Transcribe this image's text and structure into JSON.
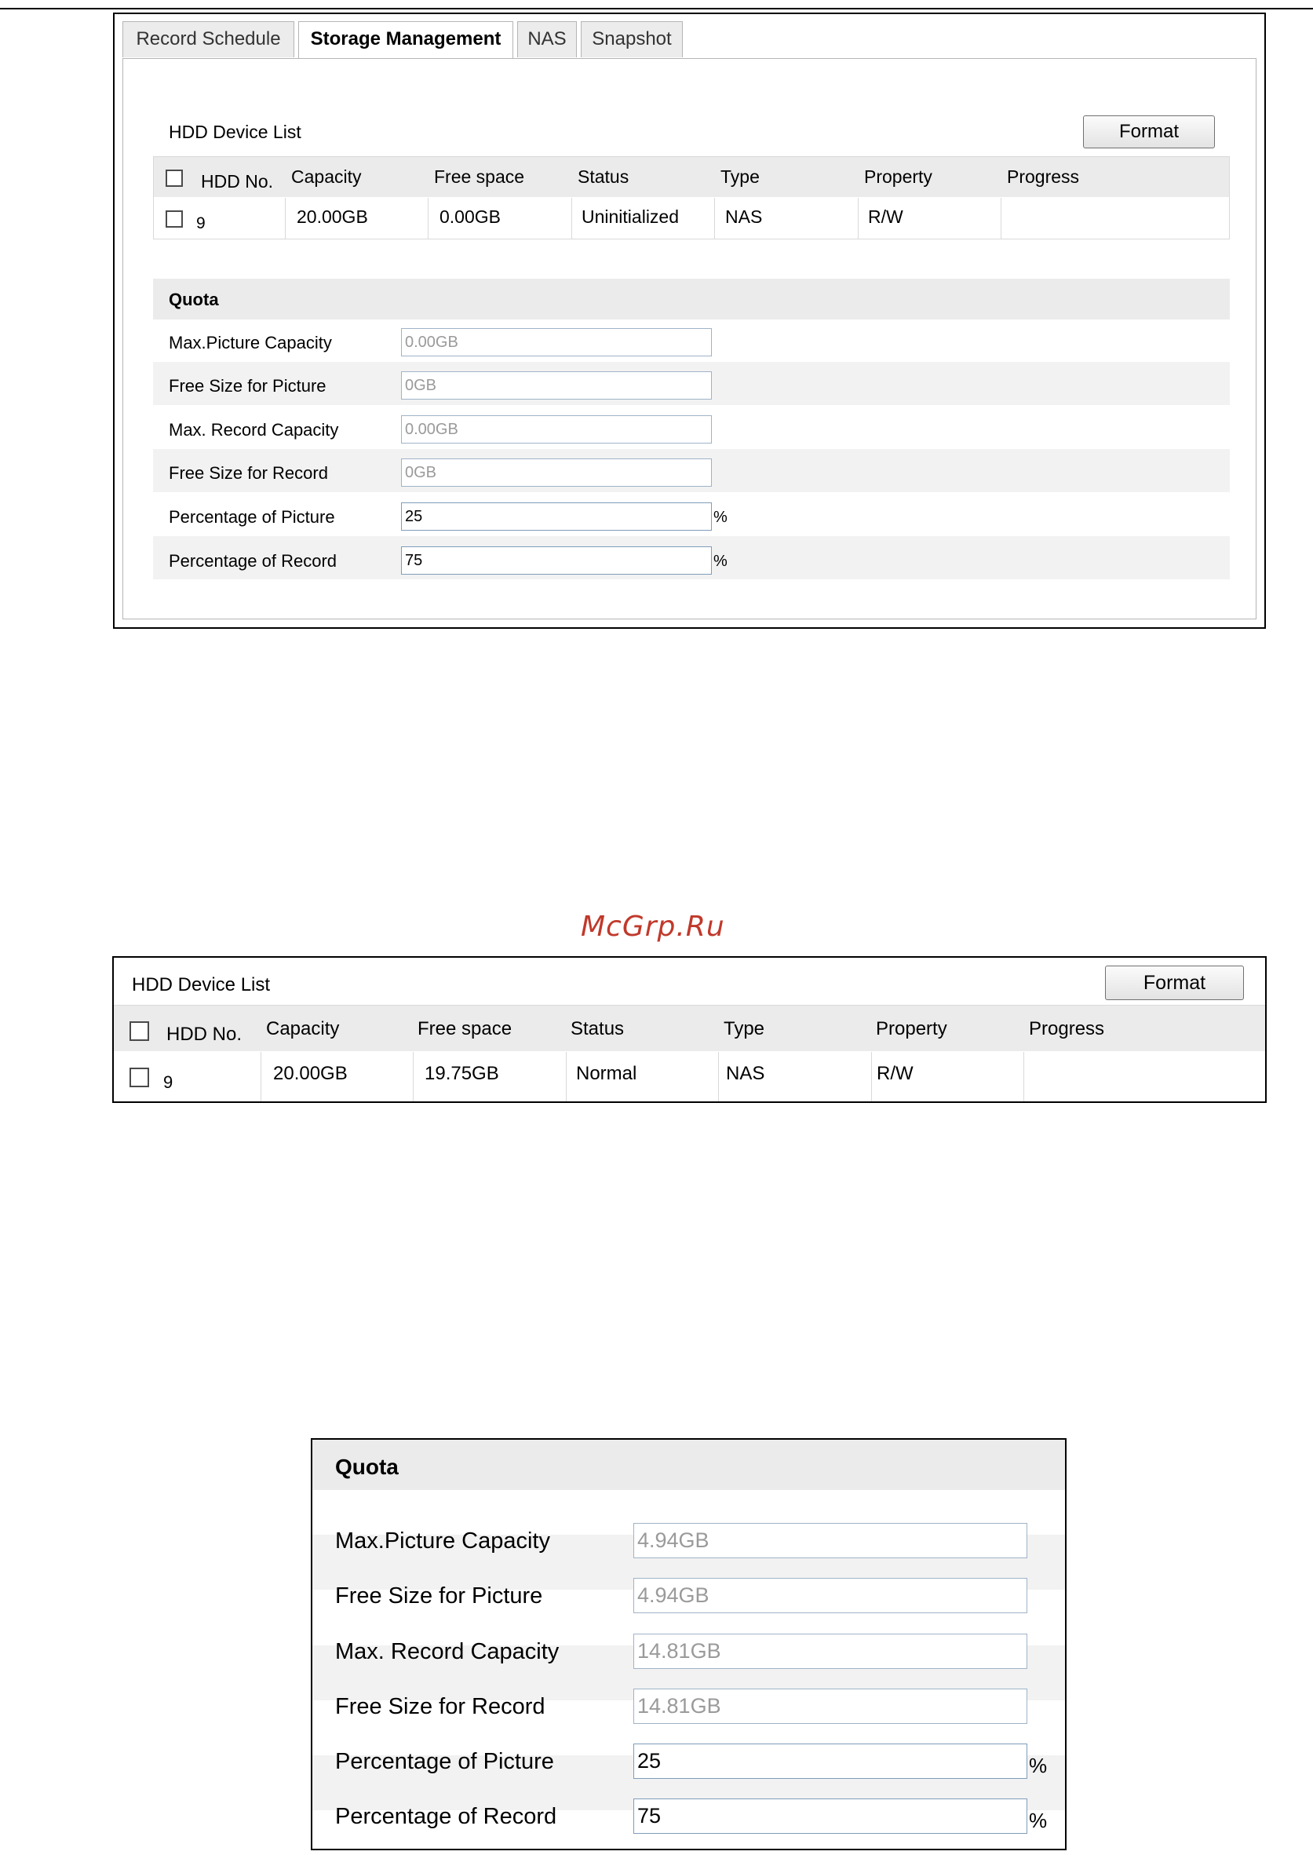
{
  "watermark": "McGrp.Ru",
  "panel1": {
    "tabs": [
      {
        "label": "Record Schedule",
        "active": false
      },
      {
        "label": "Storage Management",
        "active": true
      },
      {
        "label": "NAS",
        "active": false
      },
      {
        "label": "Snapshot",
        "active": false
      }
    ],
    "hdd_title": "HDD Device List",
    "format_label": "Format",
    "columns": [
      "HDD No.",
      "Capacity",
      "Free space",
      "Status",
      "Type",
      "Property",
      "Progress"
    ],
    "row": {
      "hdd_no": "9",
      "capacity": "20.00GB",
      "free_space": "0.00GB",
      "status": "Uninitialized",
      "type": "NAS",
      "property": "R/W",
      "progress": ""
    },
    "quota_title": "Quota",
    "quota": [
      {
        "label": "Max.Picture Capacity",
        "value": "0.00GB",
        "editable": false
      },
      {
        "label": "Free Size for Picture",
        "value": "0GB",
        "editable": false
      },
      {
        "label": "Max. Record Capacity",
        "value": "0.00GB",
        "editable": false
      },
      {
        "label": "Free Size for Record",
        "value": "0GB",
        "editable": false
      },
      {
        "label": "Percentage of Picture",
        "value": "25",
        "editable": true
      },
      {
        "label": "Percentage of Record",
        "value": "75",
        "editable": true
      }
    ],
    "percent_sign": "%"
  },
  "panel2": {
    "hdd_title": "HDD Device List",
    "format_label": "Format",
    "columns": [
      "HDD No.",
      "Capacity",
      "Free space",
      "Status",
      "Type",
      "Property",
      "Progress"
    ],
    "row": {
      "hdd_no": "9",
      "capacity": "20.00GB",
      "free_space": "19.75GB",
      "status": "Normal",
      "type": "NAS",
      "property": "R/W",
      "progress": ""
    }
  },
  "panel3": {
    "quota_title": "Quota",
    "quota": [
      {
        "label": "Max.Picture Capacity",
        "value": "4.94GB",
        "editable": false
      },
      {
        "label": "Free Size for Picture",
        "value": "4.94GB",
        "editable": false
      },
      {
        "label": "Max. Record Capacity",
        "value": "14.81GB",
        "editable": false
      },
      {
        "label": "Free Size for Record",
        "value": "14.81GB",
        "editable": false
      },
      {
        "label": "Percentage of Picture",
        "value": "25",
        "editable": true
      },
      {
        "label": "Percentage of Record",
        "value": "75",
        "editable": true
      }
    ],
    "percent_sign": "%"
  }
}
